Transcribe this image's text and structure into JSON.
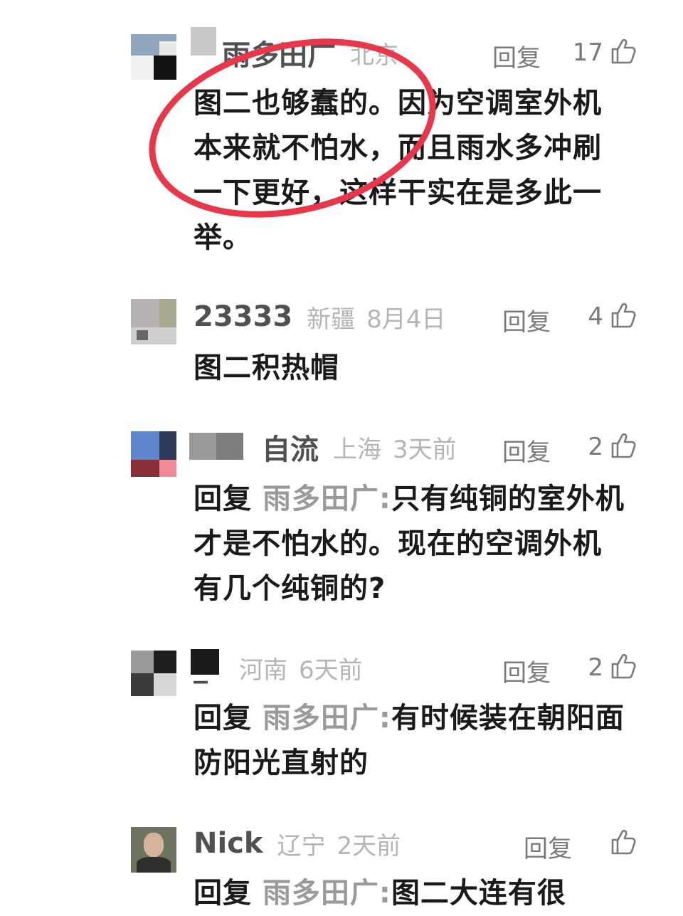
{
  "comments": [
    {
      "username": "雨多田广",
      "location": "北京",
      "date": "",
      "reply_label": "回复",
      "likes": "17",
      "text": "图二也够蠢的。因为空调室外机本来就不怕水，而且雨水多冲刷一下更好，这样干实在是多此一举。"
    },
    {
      "username": "23333",
      "location": "新疆",
      "date": "8月4日",
      "reply_label": "回复",
      "likes": "4",
      "text": "图二积热帽"
    },
    {
      "username": "自流",
      "location": "上海",
      "date": "3天前",
      "reply_label": "回复",
      "likes": "2",
      "prefix": "回复",
      "target": "雨多田广:",
      "text": "只有纯铜的室外机才是不怕水的。现在的空调外机有几个纯铜的?"
    },
    {
      "username": "_",
      "location": "河南",
      "date": "6天前",
      "reply_label": "回复",
      "likes": "2",
      "prefix": "回复",
      "target": "雨多田广:",
      "text": "有时候装在朝阳面 防阳光直射的"
    },
    {
      "username": "Nick",
      "location": "辽宁",
      "date": "2天前",
      "reply_label": "回复",
      "likes": "",
      "prefix": "回复",
      "target": "雨多田广:",
      "text": "图二大连有很"
    }
  ],
  "colors": {
    "annotation_circle": "#e8374a",
    "username": "#505050",
    "meta": "#b5b5b5"
  },
  "icons": [
    "thumbs-up-icon"
  ]
}
